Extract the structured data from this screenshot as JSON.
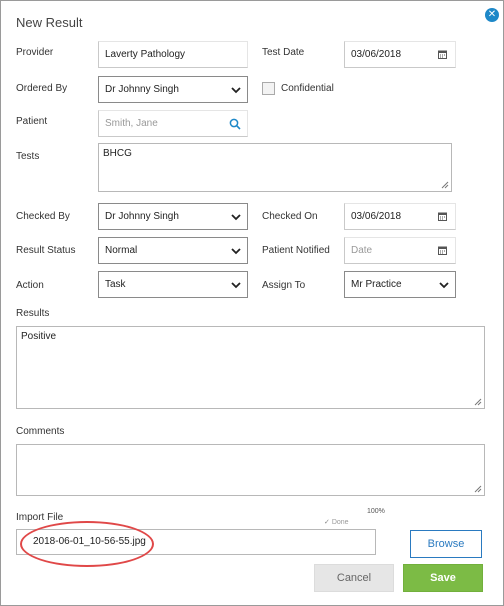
{
  "dialog": {
    "title": "New Result"
  },
  "form": {
    "provider": {
      "label": "Provider",
      "value": "Laverty Pathology"
    },
    "test_date": {
      "label": "Test Date",
      "value": "03/06/2018"
    },
    "ordered_by": {
      "label": "Ordered By",
      "value": "Dr Johnny Singh"
    },
    "confidential": {
      "label": "Confidential",
      "checked": false
    },
    "patient": {
      "label": "Patient",
      "placeholder": "Smith, Jane"
    },
    "tests": {
      "label": "Tests",
      "value": "BHCG"
    },
    "checked_by": {
      "label": "Checked By",
      "value": "Dr Johnny Singh"
    },
    "checked_on": {
      "label": "Checked On",
      "value": "03/06/2018"
    },
    "result_status": {
      "label": "Result Status",
      "value": "Normal"
    },
    "patient_notified": {
      "label": "Patient Notified",
      "placeholder": "Date"
    },
    "action": {
      "label": "Action",
      "value": "Task"
    },
    "assign_to": {
      "label": "Assign To",
      "value": "Mr Practice"
    },
    "results": {
      "label": "Results",
      "value": "Positive"
    },
    "comments": {
      "label": "Comments",
      "value": ""
    },
    "import_file": {
      "label": "Import File",
      "value": "2018-06-01_10-56-55.jpg",
      "progress_text": "100%",
      "progress": 1.0,
      "status": "Done"
    }
  },
  "buttons": {
    "browse": "Browse",
    "cancel": "Cancel",
    "save": "Save"
  },
  "colors": {
    "accent": "#1e88c8",
    "save": "#7cbb45",
    "highlight": "#e04848"
  },
  "icons": {
    "close": "close-icon",
    "calendar": "calendar-icon",
    "search": "search-icon",
    "chevron": "chevron-down-icon",
    "check": "check-icon"
  }
}
